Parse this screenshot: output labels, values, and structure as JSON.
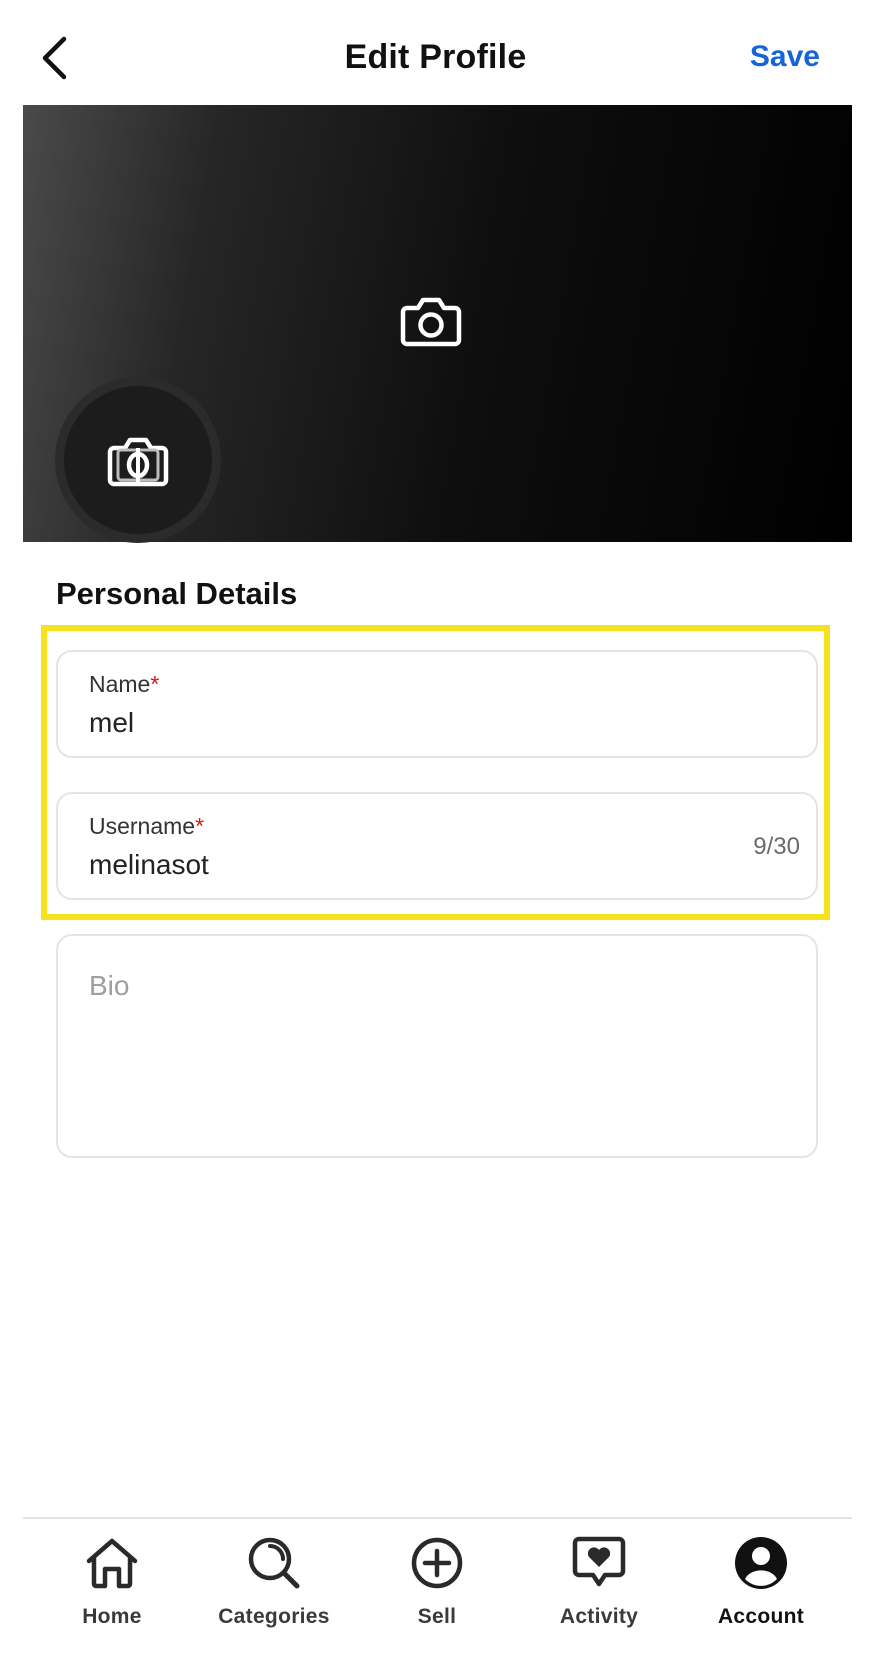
{
  "header": {
    "title": "Edit Profile",
    "save_label": "Save",
    "back_icon": "chevron-left-icon",
    "save_color": "#1565d8"
  },
  "cover": {
    "camera_icon": "camera-icon"
  },
  "avatar": {
    "camera_icon": "camera-icon"
  },
  "personal_details": {
    "title": "Personal Details",
    "name": {
      "label": "Name",
      "required_mark": "*",
      "value": "mel"
    },
    "username": {
      "label": "Username",
      "required_mark": "*",
      "value": "melinasot",
      "counter": "9/30"
    },
    "bio": {
      "placeholder": "Bio"
    },
    "highlight_color": "#f8e11c",
    "required_color": "#d21a1a"
  },
  "bottom_nav": {
    "items": [
      {
        "label": "Home",
        "icon": "home-icon"
      },
      {
        "label": "Categories",
        "icon": "search-icon"
      },
      {
        "label": "Sell",
        "icon": "plus-circle-icon"
      },
      {
        "label": "Activity",
        "icon": "heart-chat-icon"
      },
      {
        "label": "Account",
        "icon": "user-icon",
        "active": true
      }
    ]
  }
}
